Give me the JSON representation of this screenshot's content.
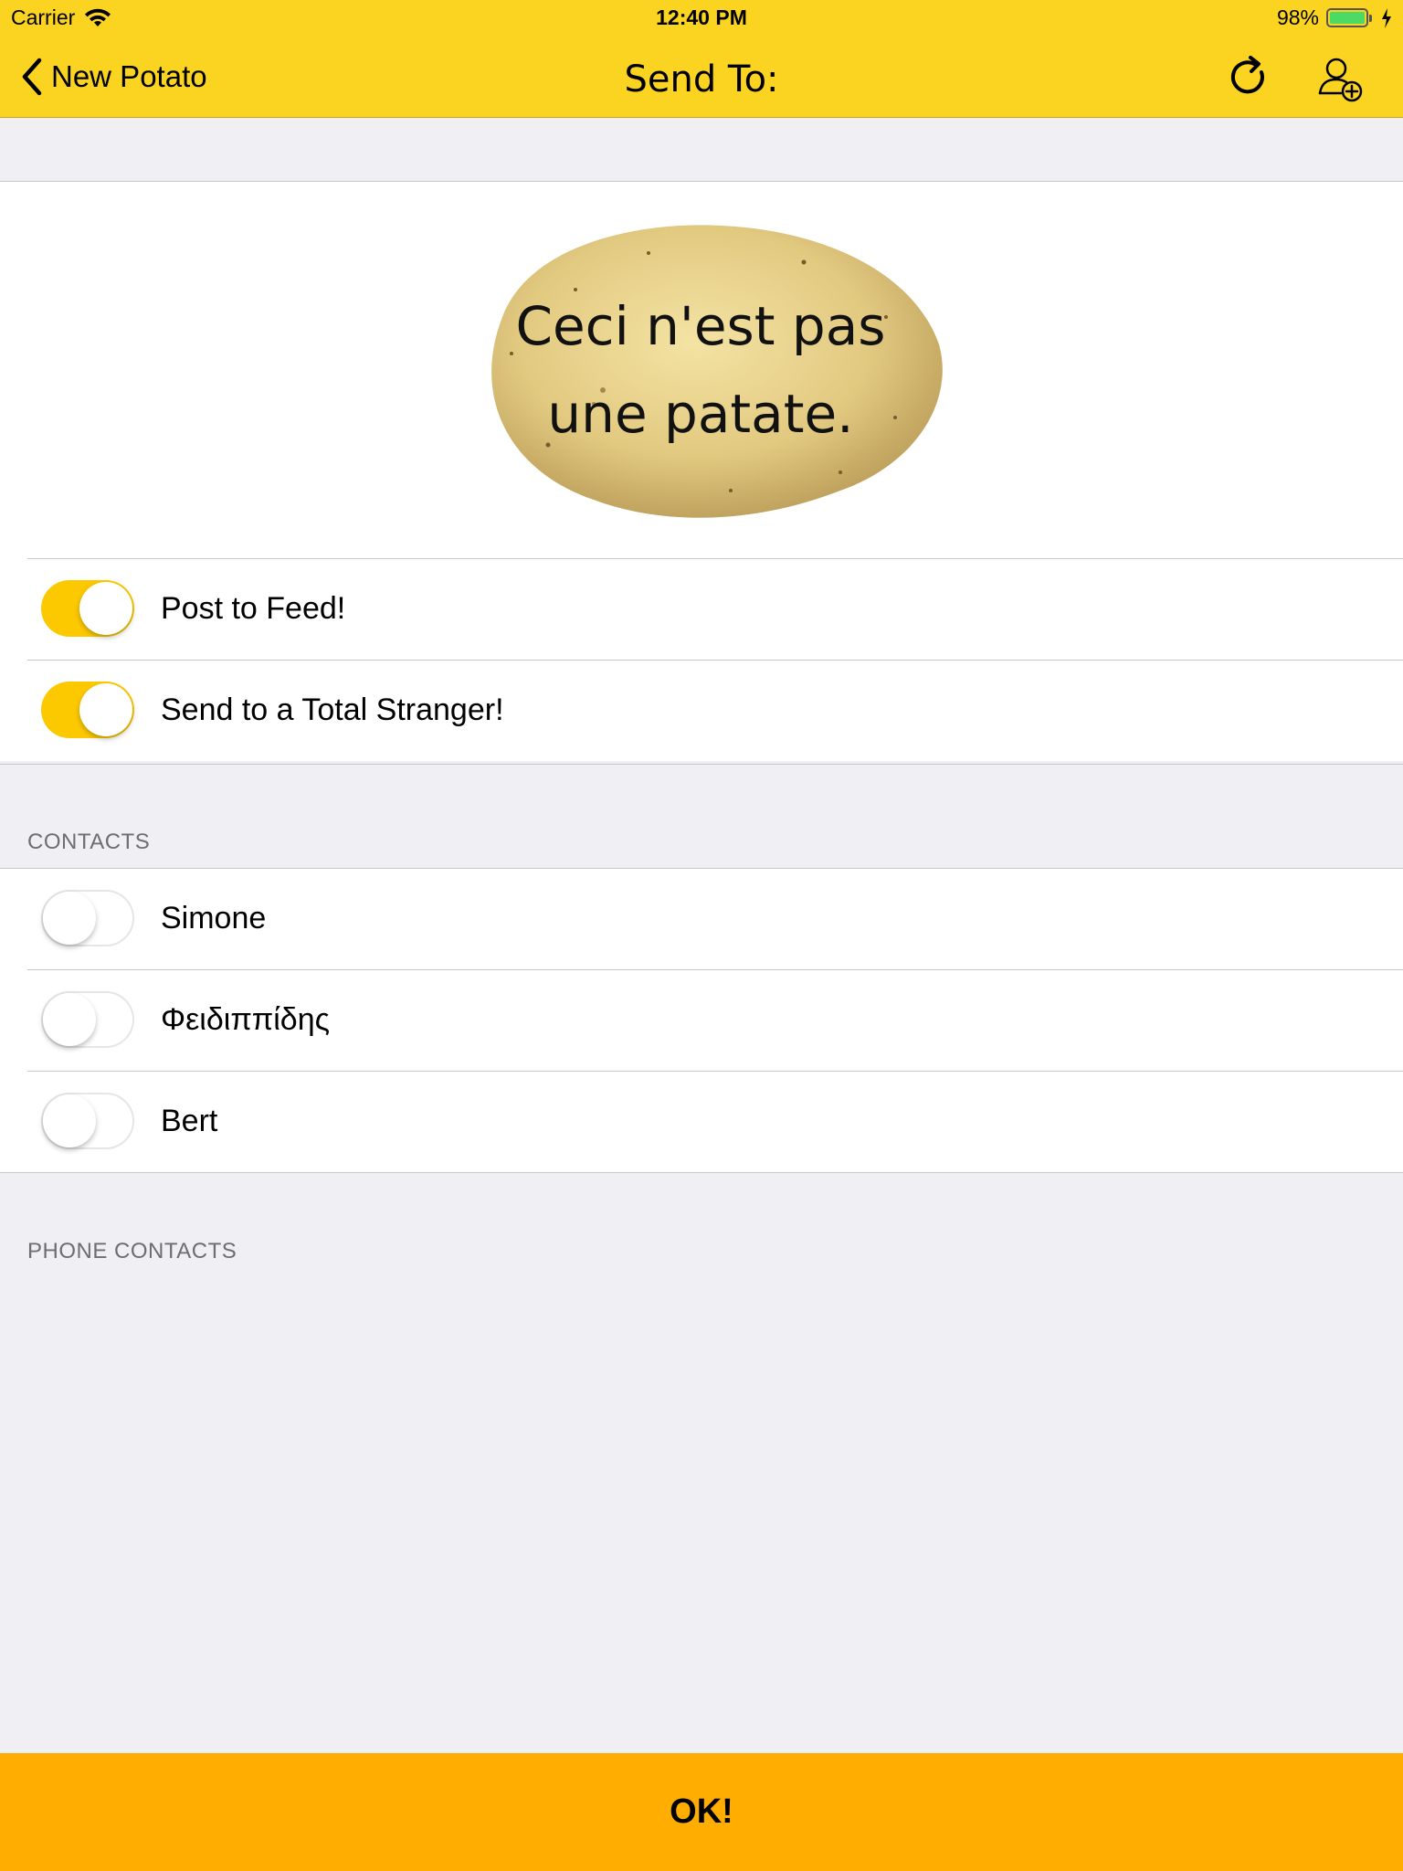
{
  "status_bar": {
    "carrier": "Carrier",
    "time": "12:40 PM",
    "battery": "98%"
  },
  "nav": {
    "back_label": "New Potato",
    "title": "Send To:",
    "icons": [
      "refresh-icon",
      "add-contact-icon"
    ]
  },
  "potato": {
    "line1": "Ceci n'est pas",
    "line2": "une patate."
  },
  "options": [
    {
      "label": "Post to Feed!",
      "on": true
    },
    {
      "label": "Send to a Total Stranger!",
      "on": true
    }
  ],
  "contacts_header": "CONTACTS",
  "contacts": [
    {
      "label": "Simone",
      "on": false
    },
    {
      "label": "Φειδιππίδης",
      "on": false
    },
    {
      "label": "Bert",
      "on": false
    }
  ],
  "phone_contacts_header": "PHONE CONTACTS",
  "ok_button": "OK!",
  "colors": {
    "bar": "#fbd321",
    "toggle_on": "#fcc900",
    "ok": "#ffad00",
    "background": "#efeff4"
  }
}
